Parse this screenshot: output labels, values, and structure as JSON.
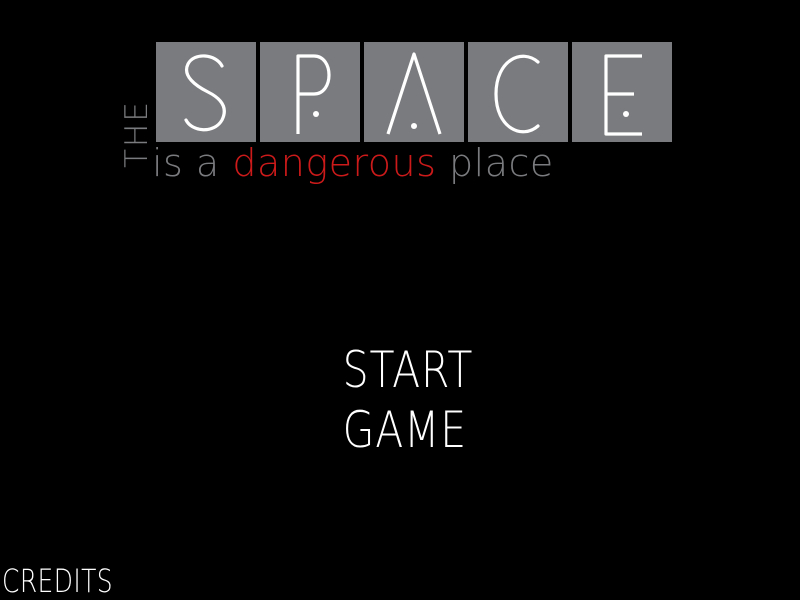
{
  "title": {
    "the": "THE",
    "space_letters": [
      "S",
      "P",
      "A",
      "C",
      "E"
    ],
    "subtitle_pre": "is a",
    "subtitle_highlight": "dangerous",
    "subtitle_post": "place"
  },
  "menu": {
    "start_line1": "START",
    "start_line2": "GAME",
    "credits": "CREDITS"
  },
  "colors": {
    "background": "#000000",
    "tile": "#7a7b7e",
    "title_grey": "#7a7b7e",
    "danger_red": "#cc1a1a",
    "menu_text": "#ffffff"
  }
}
